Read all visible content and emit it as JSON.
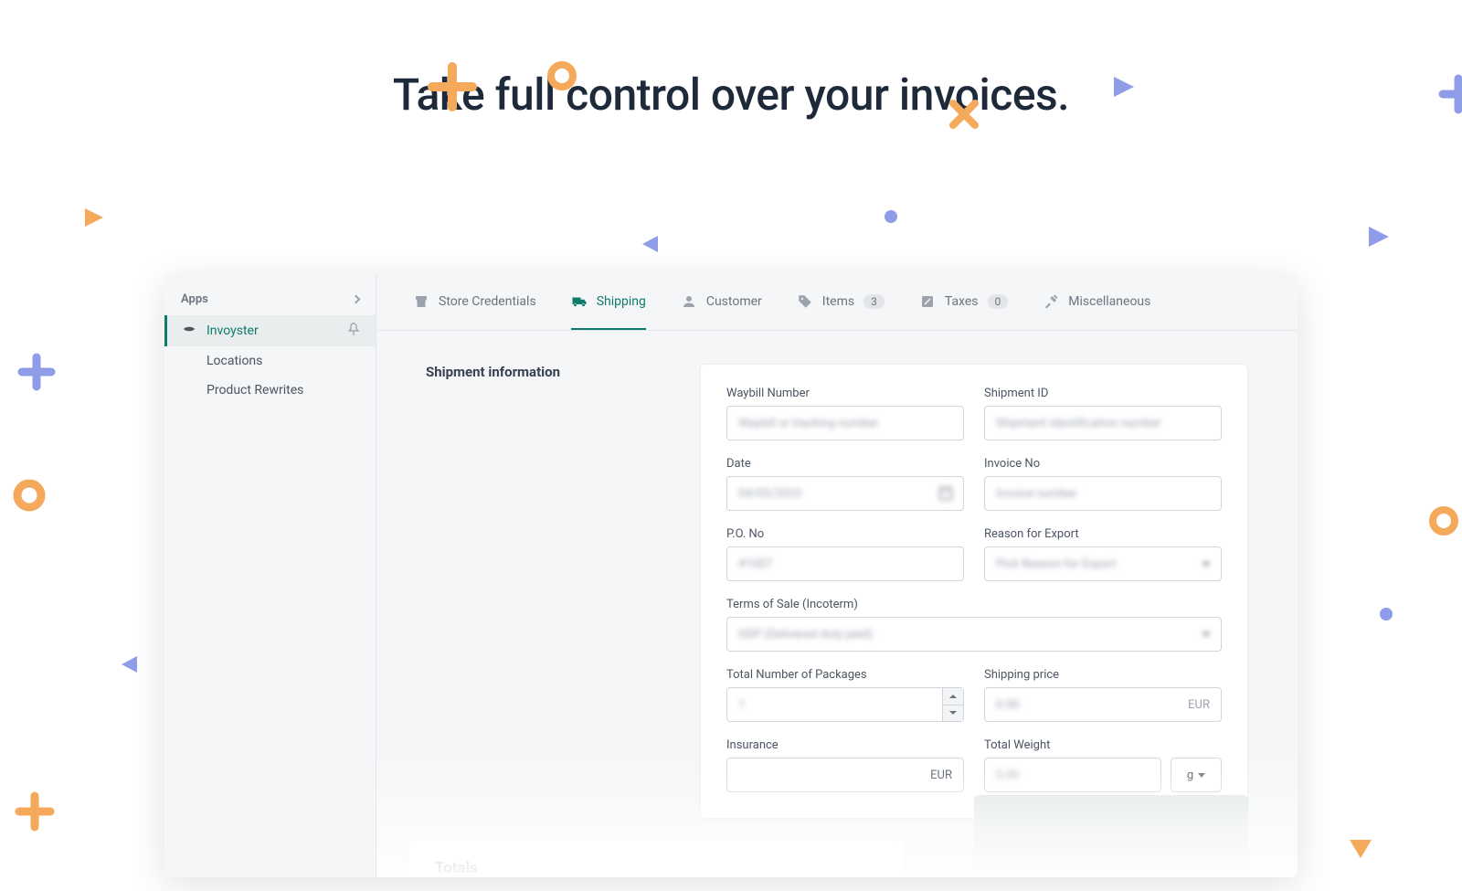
{
  "hero": {
    "title": "Take full control over your invoices."
  },
  "sidebar": {
    "header": "Apps",
    "items": [
      {
        "label": "Invoyster"
      },
      {
        "label": "Locations"
      },
      {
        "label": "Product Rewrites"
      }
    ]
  },
  "tabs": [
    {
      "label": "Store Credentials"
    },
    {
      "label": "Shipping"
    },
    {
      "label": "Customer"
    },
    {
      "label": "Items",
      "badge": "3"
    },
    {
      "label": "Taxes",
      "badge": "0"
    },
    {
      "label": "Miscellaneous"
    }
  ],
  "section": {
    "title": "Shipment information"
  },
  "form": {
    "waybill": {
      "label": "Waybill Number",
      "placeholder": "Waybill or tracking number"
    },
    "shipment_id": {
      "label": "Shipment ID",
      "placeholder": "Shipment identification number"
    },
    "date": {
      "label": "Date",
      "value": "04/05/2023"
    },
    "invoice_no": {
      "label": "Invoice No",
      "placeholder": "Invoice number"
    },
    "po_no": {
      "label": "P.O. No",
      "value": "#1007"
    },
    "reason": {
      "label": "Reason for Export",
      "value": "Pick Reason for Export"
    },
    "incoterm": {
      "label": "Terms of Sale (Incoterm)",
      "value": "DDP (Delivered duty paid)"
    },
    "packages": {
      "label": "Total Number of Packages",
      "value": "1"
    },
    "shipping_price": {
      "label": "Shipping price",
      "value": "0.00",
      "currency": "EUR"
    },
    "insurance": {
      "label": "Insurance",
      "currency": "EUR"
    },
    "weight": {
      "label": "Total Weight",
      "value": "0.00",
      "unit": "g"
    }
  },
  "totals": {
    "title": "Totals"
  }
}
